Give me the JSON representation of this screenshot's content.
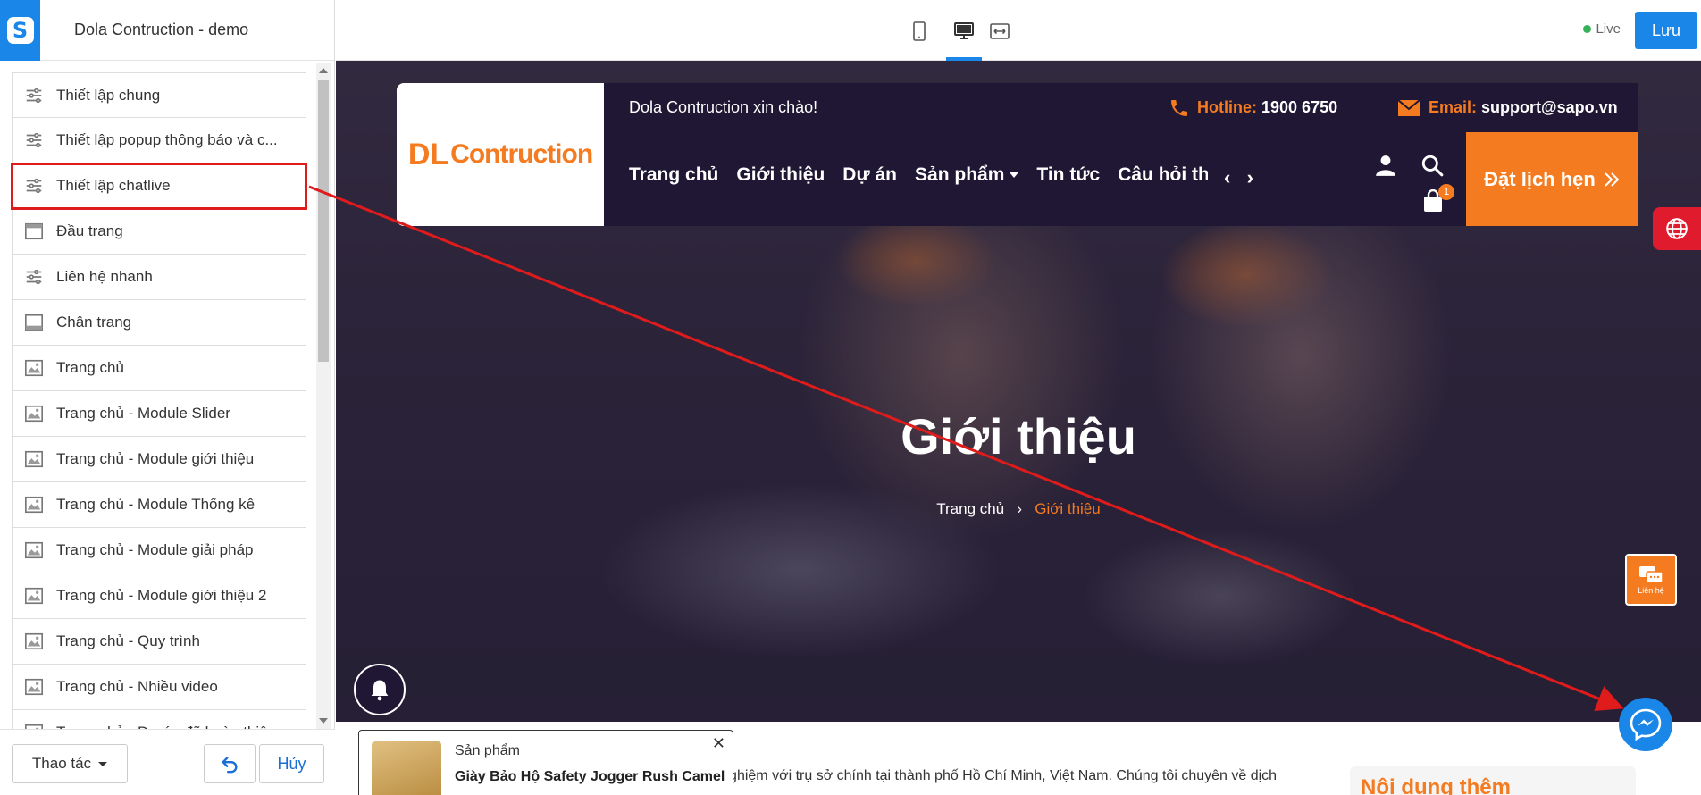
{
  "app": {
    "logo_letter": "S",
    "store_name": "Dola Contruction - demo"
  },
  "sidebar": {
    "items": [
      {
        "label": "Thiết lập chung",
        "icon": "settings-sliders-icon"
      },
      {
        "label": "Thiết lập popup thông báo và c...",
        "icon": "settings-sliders-icon"
      },
      {
        "label": "Thiết lập chatlive",
        "icon": "settings-sliders-icon",
        "selected": true
      },
      {
        "label": "Đầu trang",
        "icon": "header-layout-icon"
      },
      {
        "label": "Liên hệ nhanh",
        "icon": "settings-sliders-icon"
      },
      {
        "label": "Chân trang",
        "icon": "footer-layout-icon"
      },
      {
        "label": "Trang chủ",
        "icon": "image-section-icon"
      },
      {
        "label": "Trang chủ - Module Slider",
        "icon": "image-section-icon"
      },
      {
        "label": "Trang chủ - Module giới thiệu",
        "icon": "image-section-icon"
      },
      {
        "label": "Trang chủ - Module Thống kê",
        "icon": "image-section-icon"
      },
      {
        "label": "Trang chủ - Module giải pháp",
        "icon": "image-section-icon"
      },
      {
        "label": "Trang chủ - Module giới thiệu 2",
        "icon": "image-section-icon"
      },
      {
        "label": "Trang chủ - Quy trình",
        "icon": "image-section-icon"
      },
      {
        "label": "Trang chủ - Nhiều video",
        "icon": "image-section-icon"
      },
      {
        "label": "Trang chủ - Dự án đã hoàn thiện",
        "icon": "image-section-icon"
      }
    ]
  },
  "footer": {
    "actions_label": "Thao tác",
    "cancel_label": "Hủy"
  },
  "toolbar": {
    "live_label": "Live",
    "save_label": "Lưu"
  },
  "site": {
    "logo_text": "Contruction",
    "logo_mark": "DL",
    "greeting": "Dola Contruction xin chào!",
    "hotline_label": "Hotline:",
    "hotline_value": "1900 6750",
    "email_label": "Email:",
    "email_value": "support@sapo.vn",
    "nav": [
      "Trang chủ",
      "Giới thiệu",
      "Dự án",
      "Sản phẩm",
      "Tin tức",
      "Câu hỏi thường gặp"
    ],
    "cart_count": "1",
    "cta_label": "Đặt lịch hẹn",
    "hero_title": "Giới thiệu",
    "breadcrumb_home": "Trang chủ",
    "breadcrumb_current": "Giới thiệu",
    "contact_badge": "Liên hệ",
    "body_text": "Dola Contruction là công ty xây dựng uy tín và giàu kinh nghiệm với trụ sở chính tại thành phố Hồ Chí Minh, Việt Nam. Chúng tôi chuyên về dịch",
    "side_heading": "Nội dung thêm",
    "popup": {
      "label": "Sản phẩm",
      "product_name": "Giày Bảo Hộ Safety Jogger Rush Camel"
    }
  },
  "colors": {
    "accent": "#1a86e8",
    "brand_orange": "#f47b20",
    "header_dark": "#1f1733",
    "annotation_red": "#e01b1b"
  }
}
